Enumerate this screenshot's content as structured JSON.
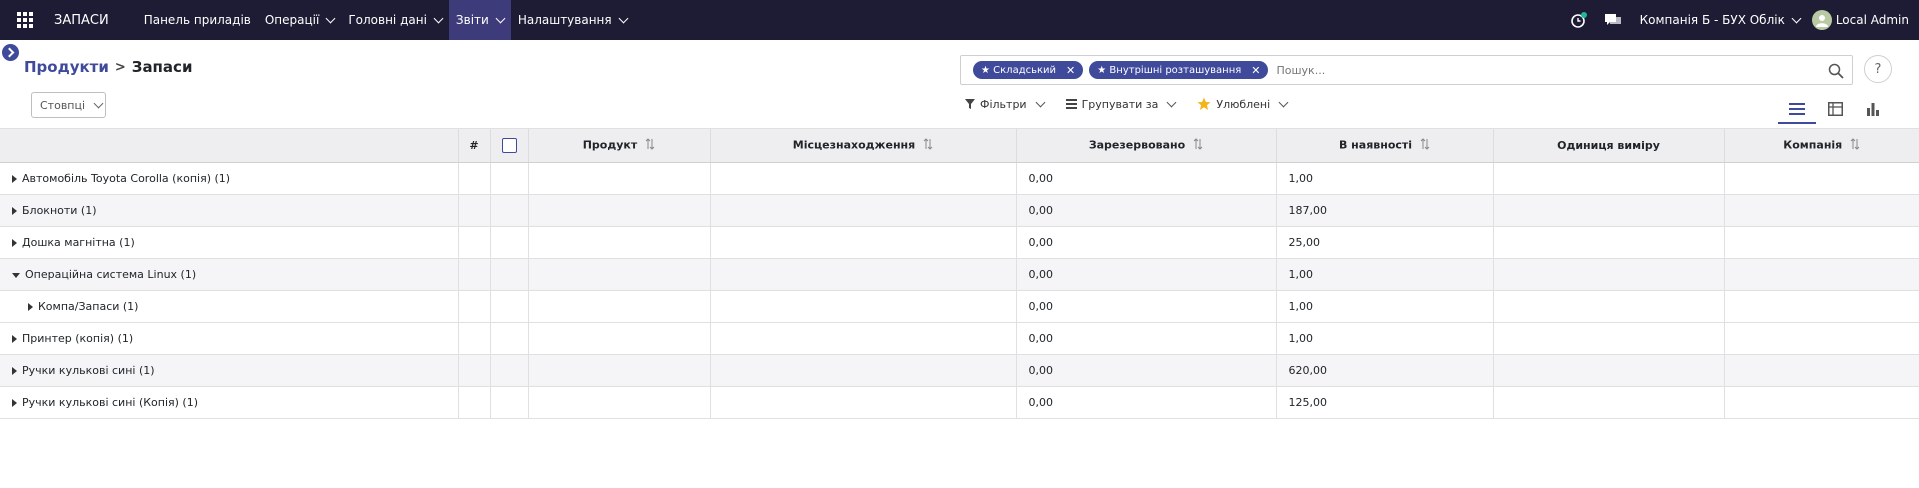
{
  "navbar": {
    "brand": "ЗАПАСИ",
    "menu": [
      {
        "label": "Панель приладів",
        "dropdown": false,
        "active": false
      },
      {
        "label": "Операції",
        "dropdown": true,
        "active": false
      },
      {
        "label": "Головні дані",
        "dropdown": true,
        "active": false
      },
      {
        "label": "Звіти",
        "dropdown": true,
        "active": true
      },
      {
        "label": "Налаштування",
        "dropdown": true,
        "active": false
      }
    ],
    "company": "Компанія Б - БУХ Облік",
    "user": "Local Admin"
  },
  "breadcrumb": {
    "parent": "Продукти",
    "separator": ">",
    "current": "Запаси"
  },
  "columns_button": "Стовпці",
  "search": {
    "facets": [
      "Складський",
      "Внутрішні розташування"
    ],
    "placeholder": "Пошук...",
    "help": "?"
  },
  "filters": {
    "filters": "Фільтри",
    "group_by": "Групувати за",
    "favorites": "Улюблені"
  },
  "table": {
    "headers": {
      "num": "#",
      "product": "Продукт",
      "location": "Місцезнаходження",
      "reserved": "Зарезервовано",
      "on_hand": "В наявності",
      "uom": "Одиниця виміру",
      "company": "Компанія"
    },
    "rows": [
      {
        "label": "Автомобіль Toyota Corolla (копія) (1)",
        "reserved": "0,00",
        "on_hand": "1,00",
        "expanded": false,
        "level": 0
      },
      {
        "label": "Блокноти (1)",
        "reserved": "0,00",
        "on_hand": "187,00",
        "expanded": false,
        "level": 0
      },
      {
        "label": "Дошка магнітна (1)",
        "reserved": "0,00",
        "on_hand": "25,00",
        "expanded": false,
        "level": 0
      },
      {
        "label": "Операційна система Linux (1)",
        "reserved": "0,00",
        "on_hand": "1,00",
        "expanded": true,
        "level": 0
      },
      {
        "label": "Компа/Запаси (1)",
        "reserved": "0,00",
        "on_hand": "1,00",
        "expanded": false,
        "level": 1
      },
      {
        "label": "Принтер (копія) (1)",
        "reserved": "0,00",
        "on_hand": "1,00",
        "expanded": false,
        "level": 0
      },
      {
        "label": "Ручки кулькові сині (1)",
        "reserved": "0,00",
        "on_hand": "620,00",
        "expanded": false,
        "level": 0
      },
      {
        "label": "Ручки кулькові сині (Копія) (1)",
        "reserved": "0,00",
        "on_hand": "125,00",
        "expanded": false,
        "level": 0
      }
    ]
  },
  "colors": {
    "navbar": "#1d1c34",
    "accent": "#3f4a9b",
    "active_menu": "#3d3b7a",
    "header_bg": "#eeeef0",
    "alt_row": "#f5f5f7"
  }
}
